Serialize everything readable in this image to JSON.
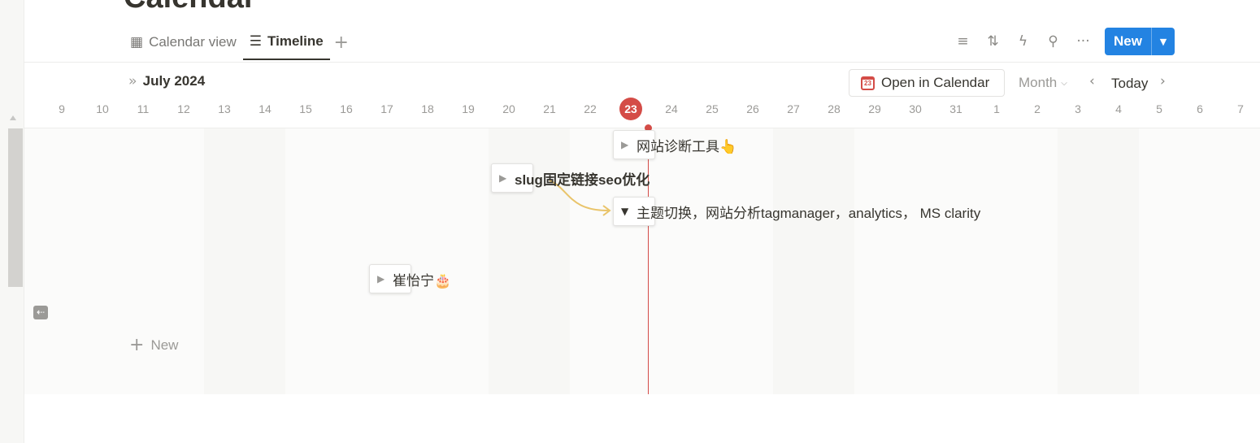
{
  "page": {
    "title": "Calendar"
  },
  "tabs": [
    {
      "label": "Calendar view",
      "icon": "calendar-icon",
      "active": false
    },
    {
      "label": "Timeline",
      "icon": "timeline-icon",
      "active": true
    }
  ],
  "toolbar": {
    "icons": [
      "filter-icon",
      "sort-icon",
      "automation-icon",
      "search-icon",
      "more-icon"
    ],
    "new_label": "New"
  },
  "timeline": {
    "month_label": "July 2024",
    "open_in_calendar_label": "Open in Calendar",
    "open_in_calendar_icon_day": "23",
    "zoom_label": "Month",
    "today_label": "Today",
    "days": [
      "9",
      "10",
      "11",
      "12",
      "13",
      "14",
      "15",
      "16",
      "17",
      "18",
      "19",
      "20",
      "21",
      "22",
      "23",
      "24",
      "25",
      "26",
      "27",
      "28",
      "29",
      "30",
      "31",
      "1",
      "2",
      "3",
      "4",
      "5",
      "6",
      "7"
    ],
    "today_day": "23",
    "today_color": "#d44c47",
    "items": [
      {
        "label": "网站诊断工具👆",
        "expanded": false
      },
      {
        "label": "slug固定链接seo优化",
        "expanded": false
      },
      {
        "label": "主题切换，网站分析tagmanager，analytics， MS clarity",
        "expanded": true
      },
      {
        "label": "崔怡宁🎂",
        "expanded": false
      }
    ],
    "dependency_color": "#e9c46a",
    "new_row_label": "New"
  },
  "colors": {
    "accent": "#2383e2",
    "text": "#37352f",
    "muted": "#9b9a97"
  }
}
